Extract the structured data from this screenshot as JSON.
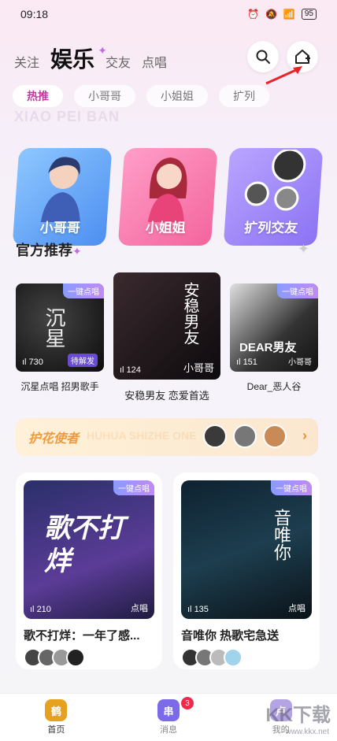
{
  "status_bar": {
    "time": "09:18",
    "battery": "95"
  },
  "top_nav": {
    "tabs": [
      "关注",
      "娱乐",
      "交友",
      "点唱"
    ],
    "active": "娱乐"
  },
  "chips": [
    "热推",
    "小哥哥",
    "小姐姐",
    "扩列"
  ],
  "watermark_text": "XIAO PEI BAN",
  "categories": [
    {
      "label": "小哥哥",
      "color": "#4d8ff1"
    },
    {
      "label": "小姐姐",
      "color": "#f3659d"
    },
    {
      "label": "扩列交友",
      "color": "#8c72f3"
    }
  ],
  "official": {
    "title": "官方推荐",
    "items": [
      {
        "title": "沉星点唱 招男歌手",
        "count": "730",
        "badge": "一键点唱",
        "tag": "待解发",
        "cover_text": "沉星"
      },
      {
        "title": "安稳男友 恋爱首选",
        "count": "124",
        "badge": "",
        "tag": "小哥哥",
        "cover_text": "安稳男友"
      },
      {
        "title": "Dear_恶人谷",
        "count": "151",
        "badge": "一键点唱",
        "tag": "小哥哥",
        "cover_text": "DEAR男友"
      }
    ]
  },
  "banner": {
    "title": "护花使者",
    "subtitle": "HUHUA SHIZHE ONE"
  },
  "rooms": [
    {
      "name": "歌不打烊：一年了感...",
      "count": "210",
      "badge": "一键点唱",
      "tag": "点唱",
      "cover_text": "歌不打烊"
    },
    {
      "name": "音唯你 热歌宅急送",
      "count": "135",
      "badge": "一键点唱",
      "tag": "点唱",
      "cover_text": "音唯你"
    }
  ],
  "tab_bar": {
    "items": [
      {
        "label": "首页",
        "icon": "home-icon",
        "glyph": "鹤"
      },
      {
        "label": "消息",
        "icon": "message-icon",
        "glyph": "串"
      },
      {
        "label": "我的",
        "icon": "profile-icon",
        "glyph": "卢"
      }
    ],
    "message_badge": "3"
  },
  "site_watermark": {
    "logo": "KK下载",
    "url": "www.kkx.net"
  }
}
